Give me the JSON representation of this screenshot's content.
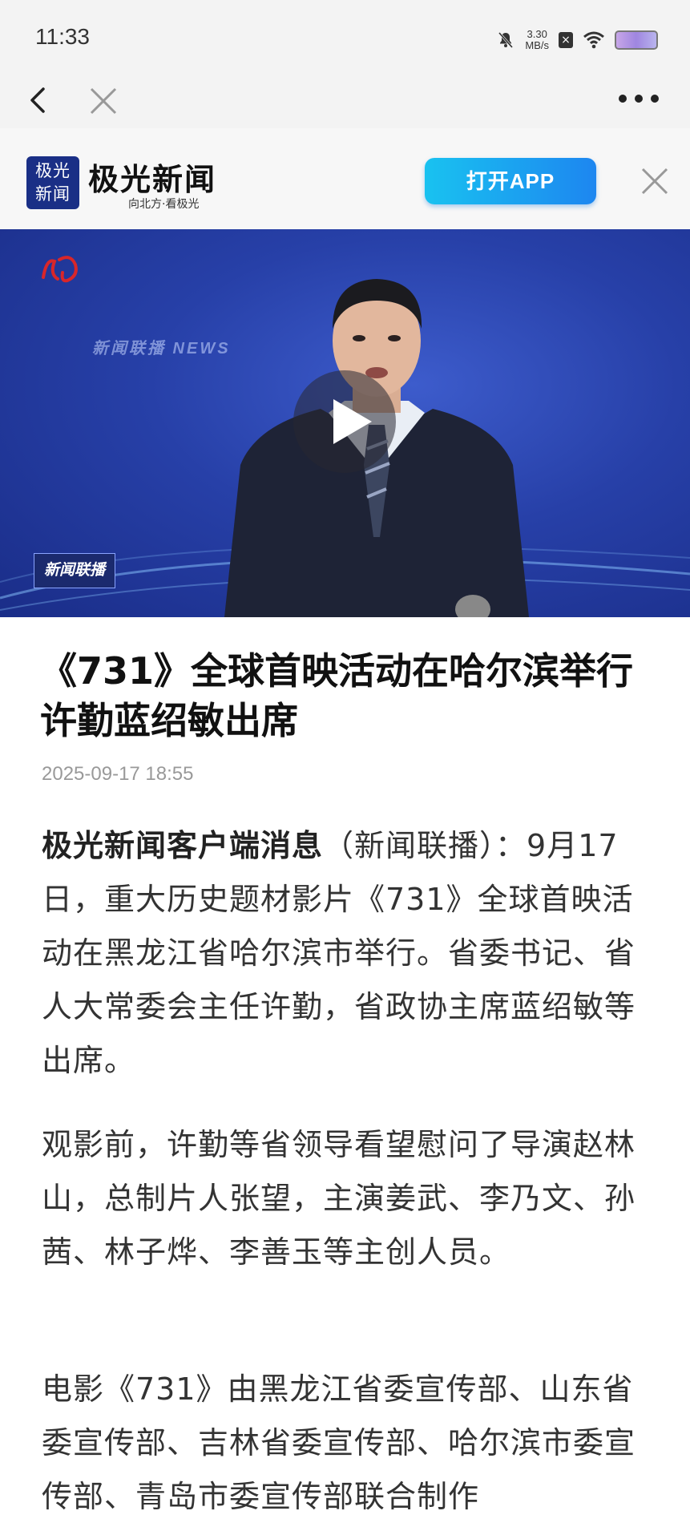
{
  "status_bar": {
    "time": "11:33",
    "net_speed_value": "3.30",
    "net_speed_unit": "MB/s"
  },
  "banner": {
    "logo_text_line1": "极光",
    "logo_text_line2": "新闻",
    "app_name": "极光新闻",
    "slogan": "向北方·看极光",
    "open_app_label": "打开APP"
  },
  "video": {
    "watermark": "新闻联播 NEWS",
    "program_badge": "新闻联播"
  },
  "article": {
    "title": "《731》全球首映活动在哈尔滨举行 许勤蓝绍敏出席",
    "date": "2025-09-17 18:55",
    "lead": "极光新闻客户端消息",
    "p1_rest": "（新闻联播）：9月17日，重大历史题材影片《731》全球首映活动在黑龙江省哈尔滨市举行。省委书记、省人大常委会主任许勤，省政协主席蓝绍敏等出席。",
    "p2": "观影前，许勤等省领导看望慰问了导演赵林山，总制片人张望，主演姜武、李乃文、孙茜、林子烨、李善玉等主创人员。",
    "p3": "电影《731》由黑龙江省委宣传部、山东省委宣传部、吉林省委宣传部、哈尔滨市委宣传部、青岛市委宣传部联合制作"
  },
  "colors": {
    "open_app_gradient_start": "#19c2f0",
    "open_app_gradient_end": "#1d86f0",
    "logo_bg": "#1a2f86",
    "video_bg": "#2740a8"
  }
}
